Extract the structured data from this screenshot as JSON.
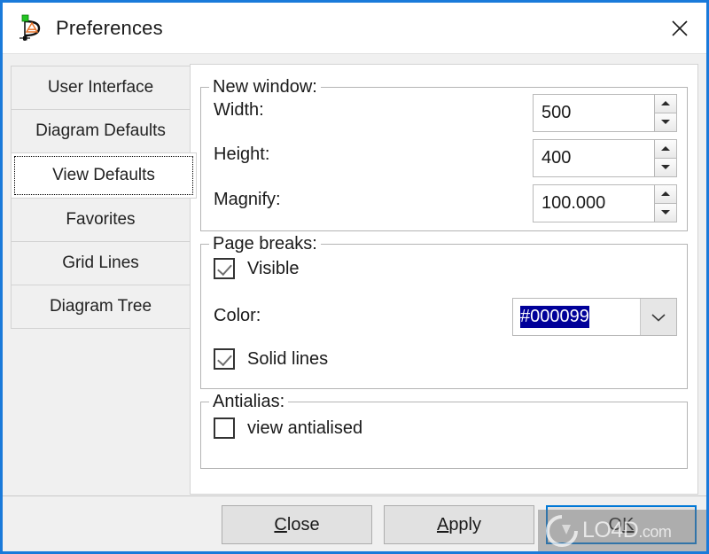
{
  "window": {
    "title": "Preferences",
    "icon": "diagram-designer-icon",
    "close_icon": "close-icon",
    "border_color": "#1a7ada"
  },
  "tabs": {
    "items": [
      {
        "label": "User Interface",
        "selected": false
      },
      {
        "label": "Diagram Defaults",
        "selected": false
      },
      {
        "label": "View Defaults",
        "selected": true
      },
      {
        "label": "Favorites",
        "selected": false
      },
      {
        "label": "Grid Lines",
        "selected": false
      },
      {
        "label": "Diagram Tree",
        "selected": false
      }
    ]
  },
  "groups": {
    "new_window": {
      "title": "New window:",
      "fields": [
        {
          "label": "Width:",
          "value": "500"
        },
        {
          "label": "Height:",
          "value": "400"
        },
        {
          "label": "Magnify:",
          "value": "100.000"
        }
      ]
    },
    "page_breaks": {
      "title": "Page breaks:",
      "visible": {
        "label": "Visible",
        "checked": true
      },
      "color": {
        "label": "Color:",
        "value": "#000099",
        "selected": true,
        "selection_color": "#000099"
      },
      "solid_lines": {
        "label": "Solid lines",
        "checked": true
      }
    },
    "antialias": {
      "title": "Antialias:",
      "view_antialised": {
        "label": "view antialised",
        "checked": false
      }
    }
  },
  "buttons": {
    "close": {
      "accel": "C",
      "rest": "lose"
    },
    "apply": {
      "accel": "A",
      "rest": "pply"
    },
    "ok": {
      "pre": "O",
      "accel": "K",
      "default": true
    }
  },
  "watermark": {
    "text": "LO4D",
    "suffix": ".com"
  }
}
